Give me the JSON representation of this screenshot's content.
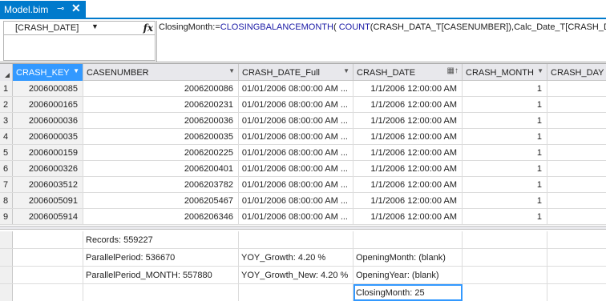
{
  "tab": {
    "title": "Model.bim",
    "pin_glyph": "⊸",
    "close_glyph": "✕"
  },
  "formula": {
    "selected_column": "[CRASH_DATE]",
    "fx_label": "fx",
    "measure_name": "ClosingMonth:=",
    "func1": "CLOSINGBALANCEMONTH",
    "paren1": "( ",
    "func2": "COUNT",
    "args": "(CRASH_DATA_T[CASENUMBER]),Calc_Date_T[CRASH_DATE])"
  },
  "columns": [
    {
      "label": "CRASH_KEY"
    },
    {
      "label": "CASENUMBER"
    },
    {
      "label": "CRASH_DATE_Full"
    },
    {
      "label": "CRASH_DATE"
    },
    {
      "label": "CRASH_MONTH"
    },
    {
      "label": "CRASH_DAY"
    }
  ],
  "rows": [
    {
      "n": "1",
      "crash_key": "2006000085",
      "casenumber": "2006200086",
      "date_full": "01/01/2006 08:00:00 AM ...",
      "crash_date": "1/1/2006 12:00:00 AM",
      "month": "1"
    },
    {
      "n": "2",
      "crash_key": "2006000165",
      "casenumber": "2006200231",
      "date_full": "01/01/2006 08:00:00 AM ...",
      "crash_date": "1/1/2006 12:00:00 AM",
      "month": "1"
    },
    {
      "n": "3",
      "crash_key": "2006000036",
      "casenumber": "2006200036",
      "date_full": "01/01/2006 08:00:00 AM ...",
      "crash_date": "1/1/2006 12:00:00 AM",
      "month": "1"
    },
    {
      "n": "4",
      "crash_key": "2006000035",
      "casenumber": "2006200035",
      "date_full": "01/01/2006 08:00:00 AM ...",
      "crash_date": "1/1/2006 12:00:00 AM",
      "month": "1"
    },
    {
      "n": "5",
      "crash_key": "2006000159",
      "casenumber": "2006200225",
      "date_full": "01/01/2006 08:00:00 AM ...",
      "crash_date": "1/1/2006 12:00:00 AM",
      "month": "1"
    },
    {
      "n": "6",
      "crash_key": "2006000326",
      "casenumber": "2006200401",
      "date_full": "01/01/2006 08:00:00 AM ...",
      "crash_date": "1/1/2006 12:00:00 AM",
      "month": "1"
    },
    {
      "n": "7",
      "crash_key": "2006003512",
      "casenumber": "2006203782",
      "date_full": "01/01/2006 08:00:00 AM ...",
      "crash_date": "1/1/2006 12:00:00 AM",
      "month": "1"
    },
    {
      "n": "8",
      "crash_key": "2006005091",
      "casenumber": "2006205467",
      "date_full": "01/01/2006 08:00:00 AM ...",
      "crash_date": "1/1/2006 12:00:00 AM",
      "month": "1"
    },
    {
      "n": "9",
      "crash_key": "2006005914",
      "casenumber": "2006206346",
      "date_full": "01/01/2006 08:00:00 AM ...",
      "crash_date": "1/1/2006 12:00:00 AM",
      "month": "1"
    }
  ],
  "measures": {
    "records": "Records: 559227",
    "parallel_period": "ParallelPeriod: 536670",
    "parallel_period_month": "ParallelPeriod_MONTH: 557880",
    "yoy_growth": "YOY_Growth: 4.20 %",
    "yoy_growth_new": "YOY_Growth_New: 4.20 %",
    "opening_month": "OpeningMonth: (blank)",
    "opening_year": "OpeningYear: (blank)",
    "closing_month": "ClosingMonth: 25"
  },
  "colors": {
    "accent": "#007acc",
    "selection": "#3399ff",
    "function_blue": "#1a1aa6"
  }
}
